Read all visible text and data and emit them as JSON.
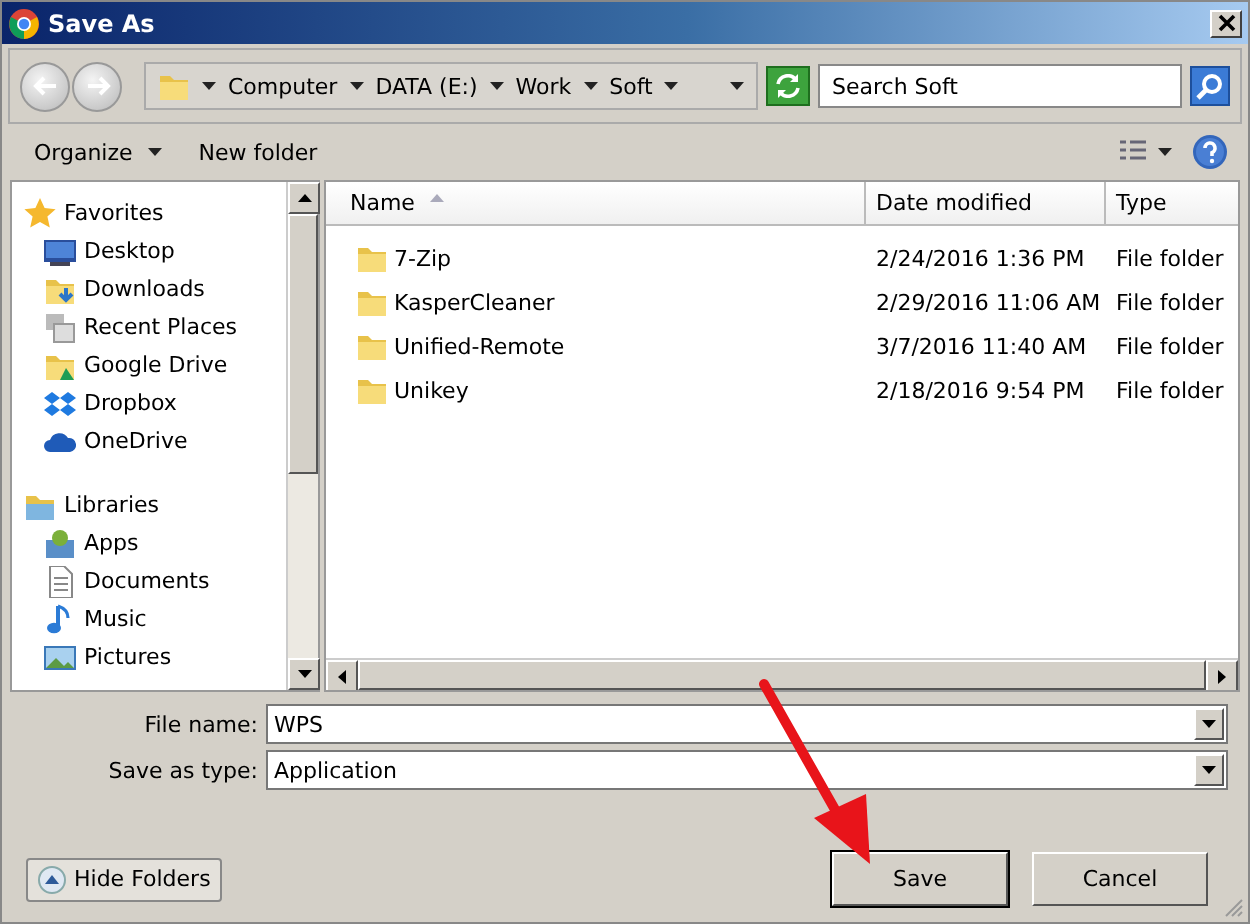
{
  "window": {
    "title": "Save As"
  },
  "address_bar": {
    "crumbs": [
      "Computer",
      "DATA (E:)",
      "Work",
      "Soft"
    ]
  },
  "search": {
    "placeholder": "Search Soft"
  },
  "toolbar": {
    "buttons": [
      {
        "label": "Organize",
        "dropdown": true
      },
      {
        "label": "New folder",
        "dropdown": false
      }
    ]
  },
  "sidebar": {
    "groups": [
      {
        "label": "Favorites",
        "children": [
          {
            "label": "Desktop"
          },
          {
            "label": "Downloads"
          },
          {
            "label": "Recent Places"
          },
          {
            "label": "Google Drive"
          },
          {
            "label": "Dropbox"
          },
          {
            "label": "OneDrive"
          }
        ]
      },
      {
        "label": "Libraries",
        "children": [
          {
            "label": "Apps"
          },
          {
            "label": "Documents"
          },
          {
            "label": "Music"
          },
          {
            "label": "Pictures"
          }
        ]
      }
    ]
  },
  "table": {
    "columns": [
      {
        "label": "Name",
        "sorted": true
      },
      {
        "label": "Date modified",
        "sorted": false
      },
      {
        "label": "Type",
        "sorted": false
      }
    ],
    "rows": [
      {
        "name": "7-Zip",
        "date": "2/24/2016 1:36 PM",
        "type": "File folder"
      },
      {
        "name": "KasperCleaner",
        "date": "2/29/2016 11:06 AM",
        "type": "File folder"
      },
      {
        "name": "Unified-Remote",
        "date": "3/7/2016 11:40 AM",
        "type": "File folder"
      },
      {
        "name": "Unikey",
        "date": "2/18/2016 9:54 PM",
        "type": "File folder"
      }
    ]
  },
  "fields": [
    {
      "label": "File name:",
      "value": "WPS"
    },
    {
      "label": "Save as type:",
      "value": "Application"
    }
  ],
  "hide_folders": {
    "label": "Hide Folders"
  },
  "buttons": [
    {
      "label": "Save",
      "default": true
    },
    {
      "label": "Cancel",
      "default": false
    }
  ]
}
